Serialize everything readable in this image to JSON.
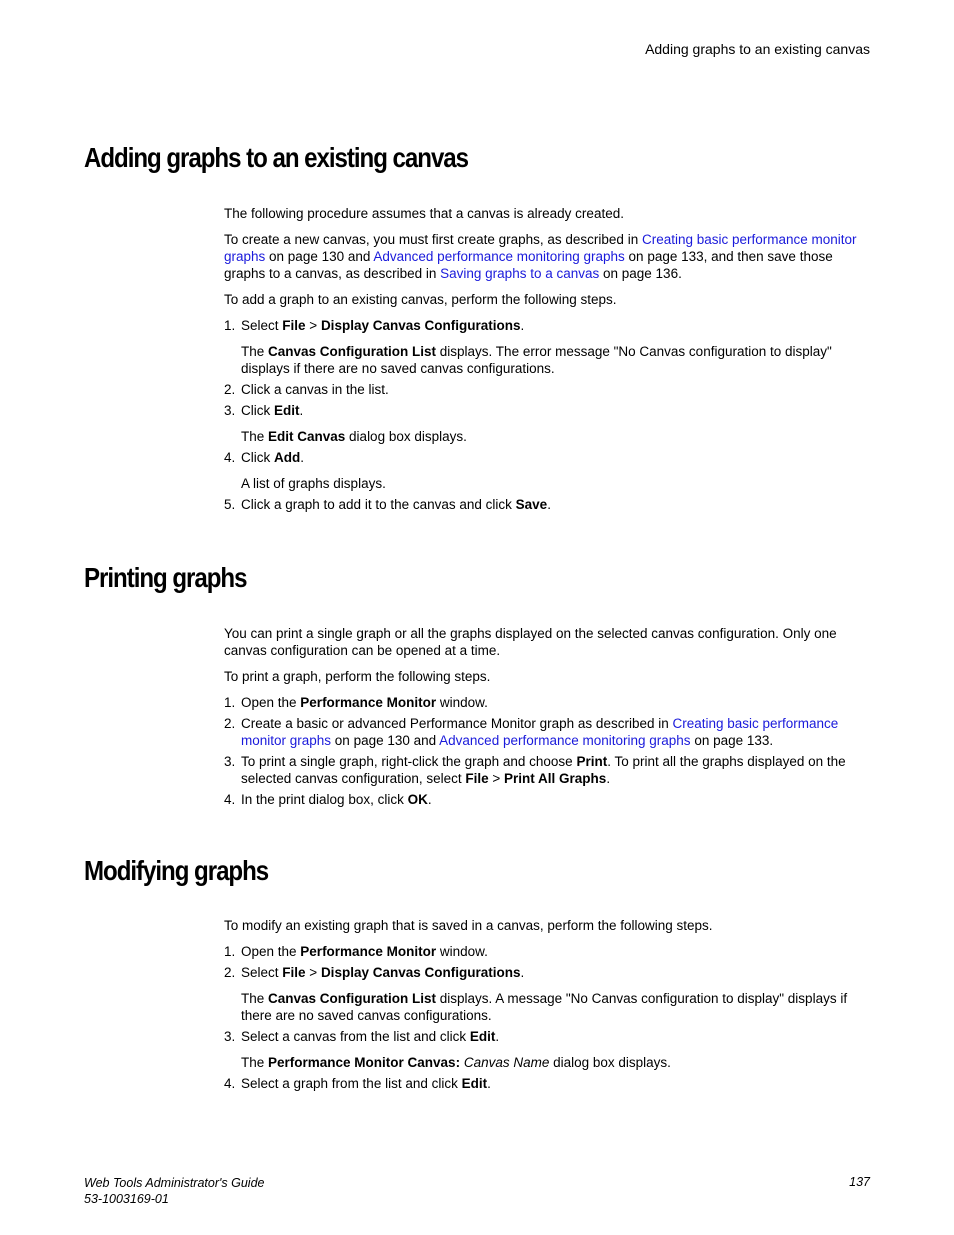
{
  "header": {
    "running_title": "Adding graphs to an existing canvas"
  },
  "sections": {
    "adding": {
      "title": "Adding graphs to an existing canvas",
      "p1": "The following procedure assumes that a canvas is already created.",
      "p2_a": "To create a new canvas, you must first create graphs, as described in ",
      "p2_link1": "Creating basic performance monitor graphs",
      "p2_b": " on page 130 and ",
      "p2_link2": "Advanced performance monitoring graphs",
      "p2_c": " on page 133, and then save those graphs to a canvas, as described in ",
      "p2_link3": "Saving graphs to a canvas",
      "p2_d": " on page 136.",
      "p3": "To add a graph to an existing canvas, perform the following steps.",
      "step1_num": "1.",
      "step1_a": "Select ",
      "step1_b1": "File",
      "step1_sep": "  > ",
      "step1_b2": "Display Canvas Configurations",
      "step1_end": ".",
      "step1_sub_a": "The ",
      "step1_sub_b": "Canvas Configuration List",
      "step1_sub_c": " displays. The error message \"No Canvas configuration to display\" displays if there are no saved canvas configurations.",
      "step2_num": "2.",
      "step2": "Click a canvas in the list.",
      "step3_num": "3.",
      "step3_a": "Click ",
      "step3_b": "Edit",
      "step3_end": ".",
      "step3_sub_a": "The ",
      "step3_sub_b": "Edit Canvas",
      "step3_sub_c": " dialog box displays.",
      "step4_num": "4.",
      "step4_a": "Click ",
      "step4_b": "Add",
      "step4_end": ".",
      "step4_sub": "A list of graphs displays.",
      "step5_num": "5.",
      "step5_a": "Click a graph to add it to the canvas and click ",
      "step5_b": "Save",
      "step5_end": "."
    },
    "printing": {
      "title": "Printing graphs",
      "p1": "You can print a single graph or all the graphs displayed on the selected canvas configuration. Only one canvas configuration can be opened at a time.",
      "p2": "To print a graph, perform the following steps.",
      "step1_num": "1.",
      "step1_a": "Open the ",
      "step1_b": "Performance Monitor",
      "step1_c": " window.",
      "step2_num": "2.",
      "step2_a": "Create a basic or advanced Performance Monitor graph as described in ",
      "step2_link1": "Creating basic performance monitor graphs",
      "step2_b": " on page 130 and ",
      "step2_link2": "Advanced performance monitoring graphs",
      "step2_c": " on page 133.",
      "step3_num": "3.",
      "step3_a": "To print a single graph, right-click the graph and choose ",
      "step3_b": "Print",
      "step3_c": ". To print all the graphs displayed on the selected canvas configuration, select ",
      "step3_d": "File",
      "step3_sep": "  > ",
      "step3_e": "Print All Graphs",
      "step3_end": ".",
      "step4_num": "4.",
      "step4_a": "In the print dialog box, click ",
      "step4_b": "OK",
      "step4_end": "."
    },
    "modifying": {
      "title": "Modifying graphs",
      "p1": "To modify an existing graph that is saved in a canvas, perform the following steps.",
      "step1_num": "1.",
      "step1_a": "Open the ",
      "step1_b": "Performance Monitor",
      "step1_c": " window.",
      "step2_num": "2.",
      "step2_a": "Select ",
      "step2_b1": "File",
      "step2_sep": "  > ",
      "step2_b2": "Display Canvas Configurations",
      "step2_end": ".",
      "step2_sub_a": "The ",
      "step2_sub_b": "Canvas Configuration List",
      "step2_sub_c": " displays. A message \"No Canvas configuration to display\" displays if there are no saved canvas configurations.",
      "step3_num": "3.",
      "step3_a": "Select a canvas from the list and click ",
      "step3_b": "Edit",
      "step3_end": ".",
      "step3_sub_a": "The ",
      "step3_sub_b": "Performance Monitor Canvas:",
      "step3_sub_i": " Canvas Name",
      "step3_sub_c": " dialog box displays.",
      "step4_num": "4.",
      "step4_a": "Select a graph from the list and click ",
      "step4_b": "Edit",
      "step4_end": "."
    }
  },
  "footer": {
    "guide_title": "Web Tools Administrator's Guide",
    "doc_number": "53-1003169-01",
    "page_number": "137"
  }
}
